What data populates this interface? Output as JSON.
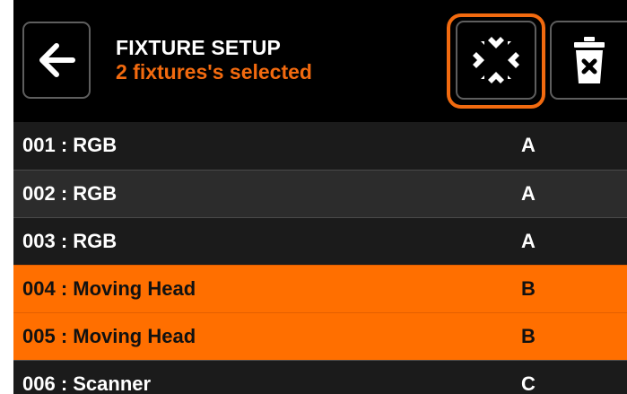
{
  "header": {
    "title": "FIXTURE SETUP",
    "subtitle": "2 fixtures's selected",
    "back_icon": "arrow-left-icon",
    "merge_icon": "collapse-arrows-icon",
    "delete_icon": "trash-x-icon"
  },
  "colors": {
    "accent": "#f26a0f",
    "selected_row": "#ff6f00",
    "background": "#000000"
  },
  "fixtures": [
    {
      "name": "001 : RGB",
      "group": "A",
      "selected": false
    },
    {
      "name": "002 : RGB",
      "group": "A",
      "selected": false
    },
    {
      "name": "003 : RGB",
      "group": "A",
      "selected": false
    },
    {
      "name": "004 : Moving Head",
      "group": "B",
      "selected": true
    },
    {
      "name": "005 : Moving Head",
      "group": "B",
      "selected": true
    },
    {
      "name": "006 : Scanner",
      "group": "C",
      "selected": false
    }
  ]
}
